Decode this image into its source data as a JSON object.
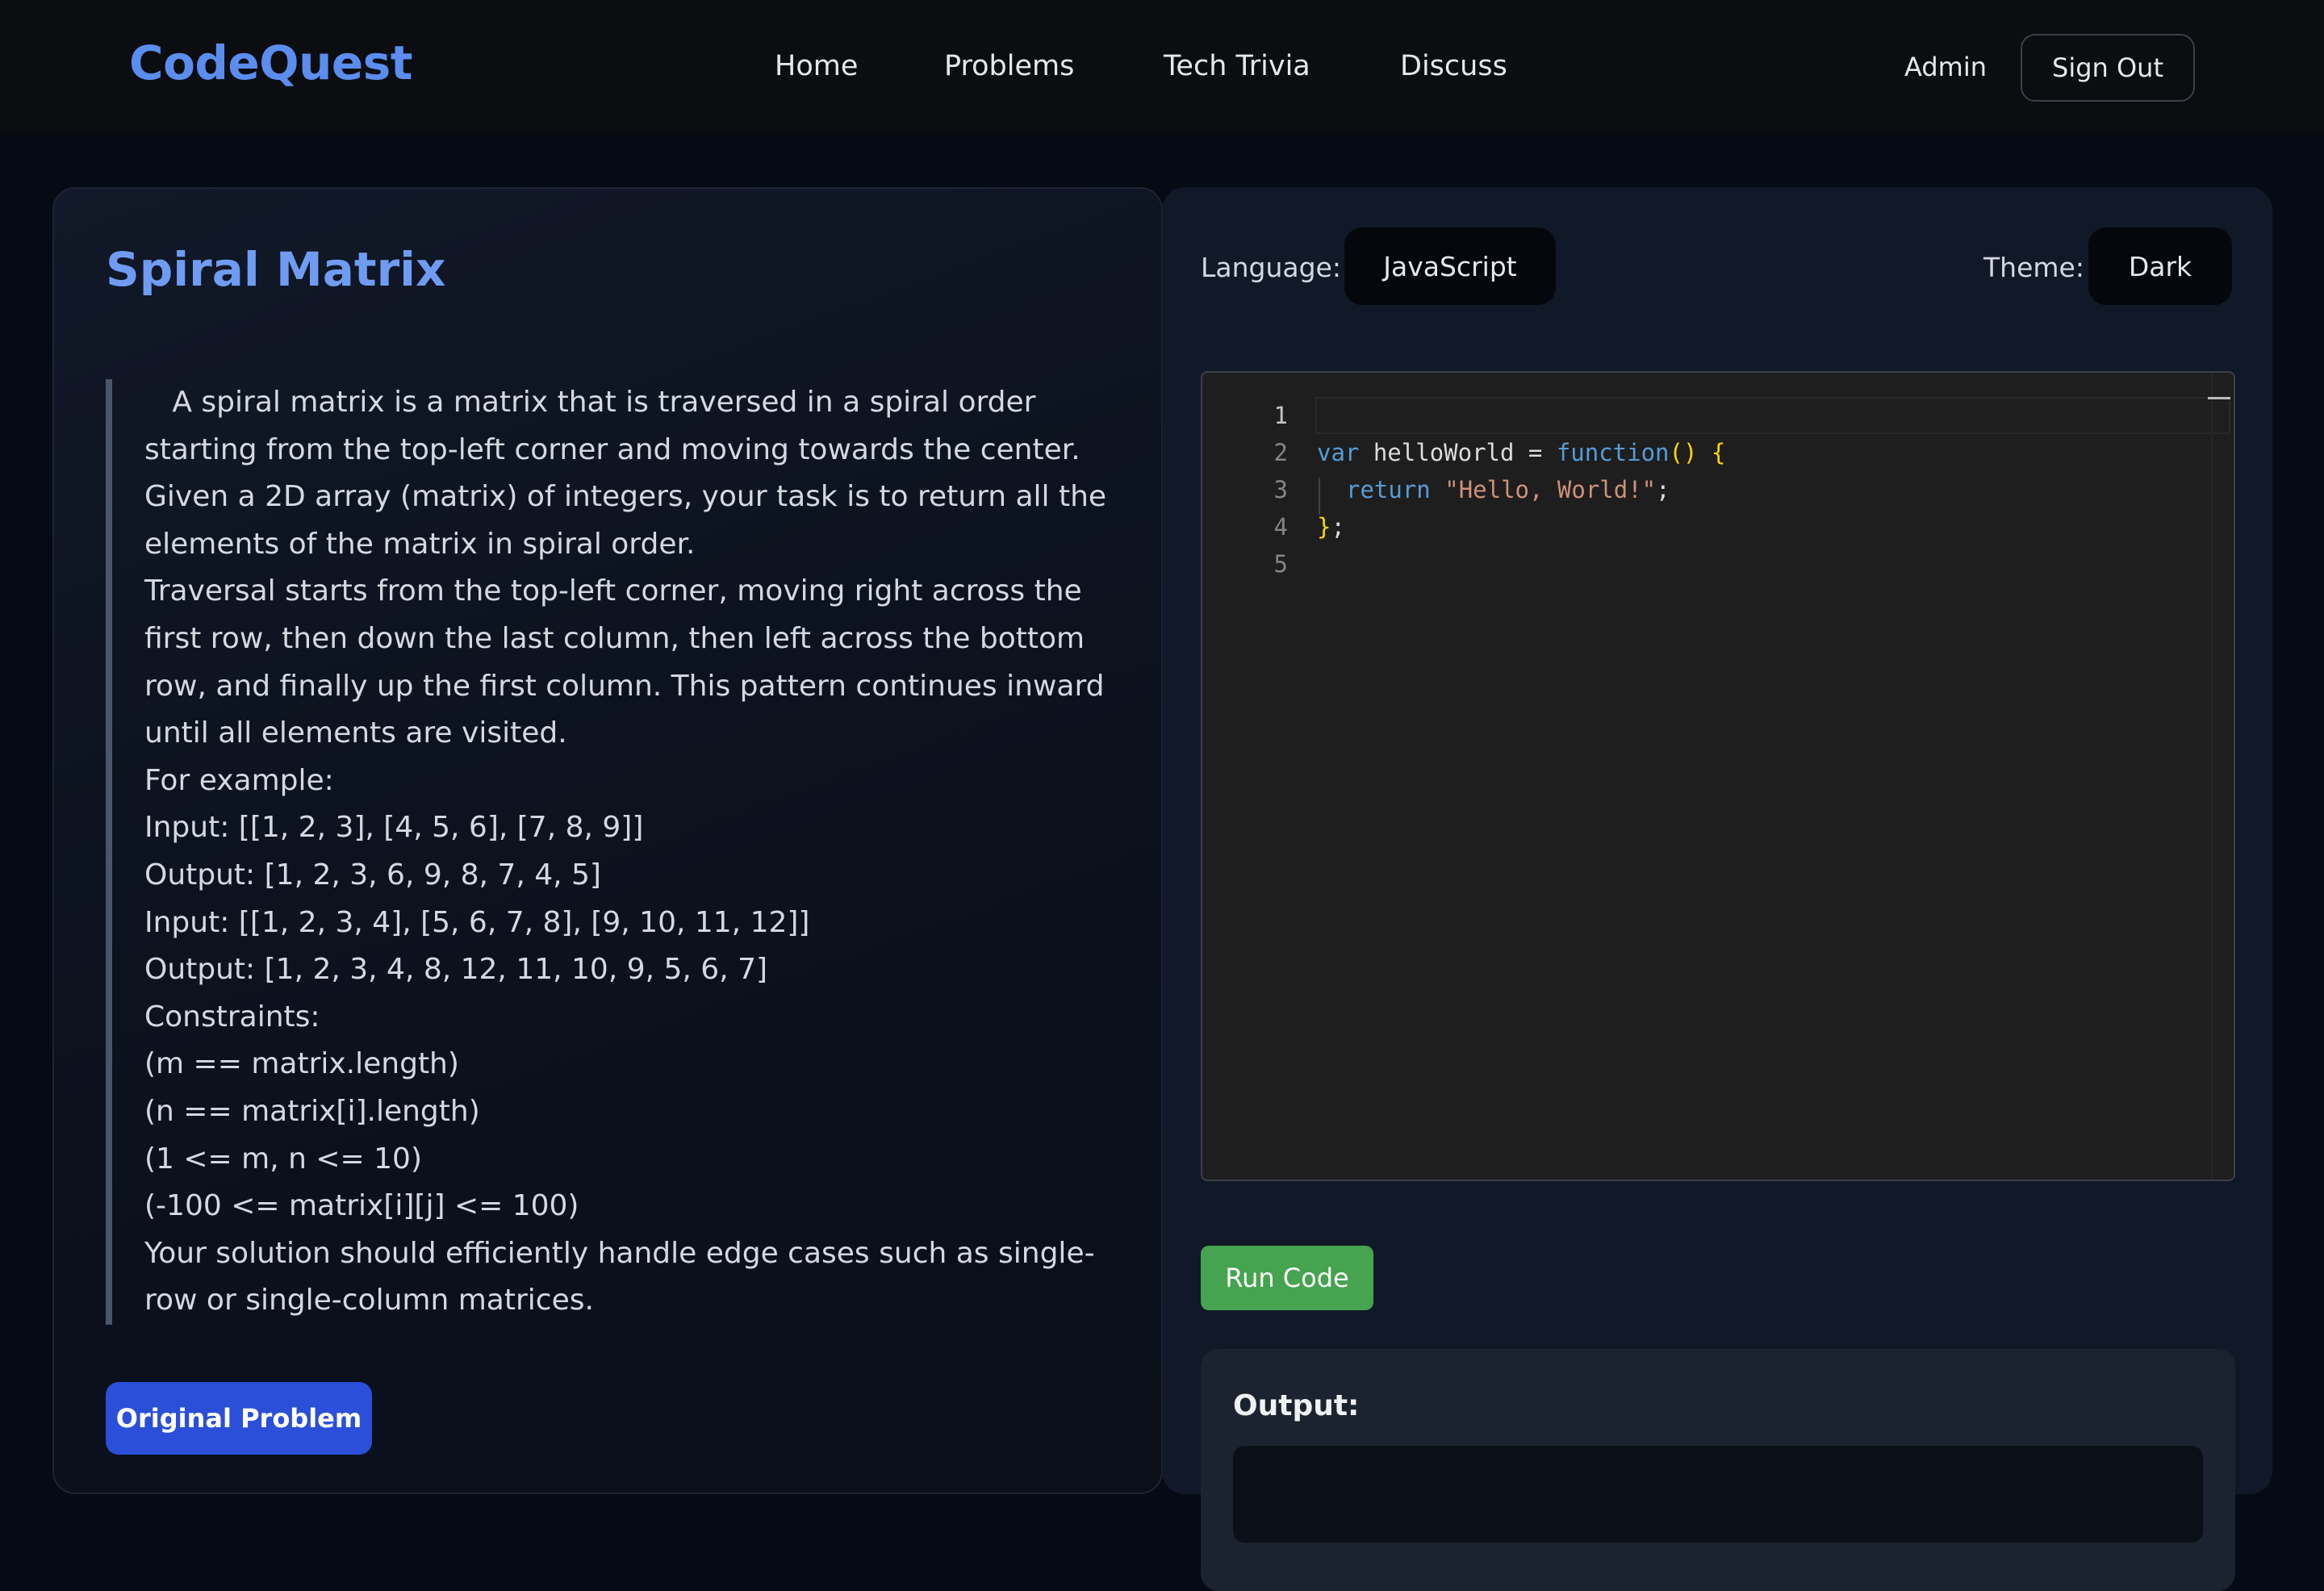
{
  "nav": {
    "brand": "CodeQuest",
    "links": [
      "Home",
      "Problems",
      "Tech Trivia",
      "Discuss"
    ],
    "user": "Admin",
    "sign_out": "Sign Out"
  },
  "problem": {
    "title": "Spiral Matrix",
    "paragraphs": [
      "   A spiral matrix is a matrix that is traversed in a spiral order starting from the top-left corner and moving towards the center. Given a 2D array (matrix) of integers, your task is to return all the elements of the matrix in spiral order.",
      "Traversal starts from the top-left corner, moving right across the first row, then down the last column, then left across the bottom row, and finally up the first column. This pattern continues inward until all elements are visited.",
      "For example:",
      "Input: [[1, 2, 3], [4, 5, 6], [7, 8, 9]]",
      "Output: [1, 2, 3, 6, 9, 8, 7, 4, 5]",
      "Input: [[1, 2, 3, 4], [5, 6, 7, 8], [9, 10, 11, 12]]",
      "Output: [1, 2, 3, 4, 8, 12, 11, 10, 9, 5, 6, 7]",
      "Constraints:",
      "(m == matrix.length)",
      "(n == matrix[i].length)",
      "(1 <= m, n <= 10)",
      "(-100 <= matrix[i][j] <= 100)",
      "Your solution should efficiently handle edge cases such as single-row or single-column matrices."
    ],
    "original_button": "Original Problem"
  },
  "editor": {
    "language_label": "Language:",
    "language_value": "JavaScript",
    "theme_label": "Theme:",
    "theme_value": "Dark",
    "line_numbers": [
      "1",
      "2",
      "3",
      "4",
      "5"
    ],
    "code": {
      "l2_kw": "var",
      "l2_id": " helloWorld = ",
      "l2_fn": "function",
      "l2_paren": "()",
      "l2_brace": " {",
      "l3_ret": "return",
      "l3_str": "\"Hello, World!\"",
      "l3_semi": ";",
      "l4_brace": "}",
      "l4_semi": ";"
    },
    "run_button": "Run Code",
    "output_title": "Output:"
  },
  "colors": {
    "brand": "#5b8def",
    "title": "#6f9cf2",
    "run": "#46a34f",
    "primary": "#2b4fd8"
  }
}
